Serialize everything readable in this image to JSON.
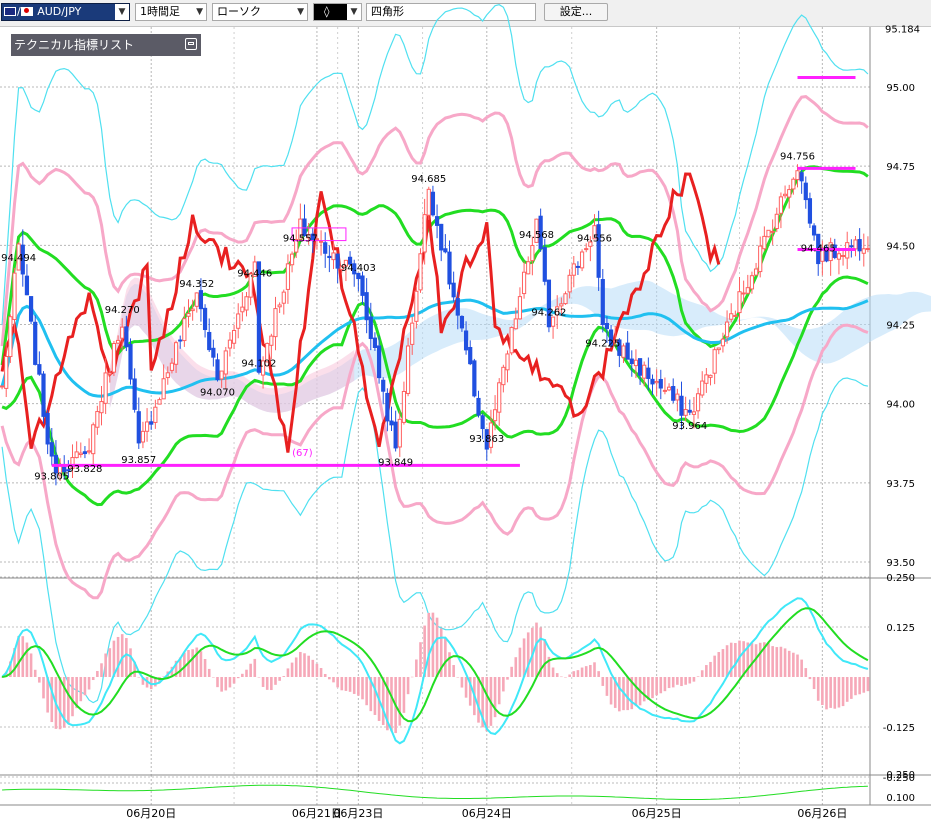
{
  "toolbar": {
    "symbol": "AUD/JPY",
    "timeframe": "1時間足",
    "chart_type": "ローソク",
    "draw_tool": "◊",
    "shape": "四角形",
    "settings_label": "設定..."
  },
  "indicator_panel": {
    "label": "テクニカル指標リスト"
  },
  "colors": {
    "bull": "#ff6060",
    "bear": "#2050e0",
    "red_line": "#e82020",
    "sma_green": "#22dd22",
    "bb_pink": "#f7a8c8",
    "bb_cyan": "#50e0f0",
    "mid_cyan": "#20c0f0",
    "magenta": "#ff20ff",
    "cloud": "#b8dcf8"
  },
  "chart_data": [
    {
      "type": "candlestick",
      "ylim": [
        93.45,
        95.2
      ],
      "yticks": [
        "95.00",
        "94.75",
        "94.50",
        "94.25",
        "94.00",
        "93.75",
        "93.50"
      ],
      "ytick_values": [
        95.0,
        94.75,
        94.5,
        94.25,
        94.0,
        93.75,
        93.5
      ],
      "ytop_label": "95.184",
      "ytop_value": 95.184,
      "xticks": [
        "06月20日",
        "06月21日",
        "06月23日",
        "06月24日",
        "06月25日",
        "06月26日"
      ],
      "xtick_index": [
        36,
        76,
        86,
        117,
        158,
        198
      ],
      "n_bars": 210,
      "price_labels": [
        {
          "text": "94.494",
          "i": 4,
          "v": 94.494
        },
        {
          "text": "93.805",
          "i": 12,
          "v": 93.805
        },
        {
          "text": "93.828",
          "i": 20,
          "v": 93.828
        },
        {
          "text": "94.270",
          "i": 29,
          "v": 94.27
        },
        {
          "text": "93.857",
          "i": 33,
          "v": 93.857
        },
        {
          "text": "94.352",
          "i": 47,
          "v": 94.352
        },
        {
          "text": "94.070",
          "i": 52,
          "v": 94.07
        },
        {
          "text": "94.446",
          "i": 61,
          "v": 94.446
        },
        {
          "text": "94.102",
          "i": 62,
          "v": 94.102
        },
        {
          "text": "94.557",
          "i": 72,
          "v": 94.557
        },
        {
          "text": "94.403",
          "i": 86,
          "v": 94.403
        },
        {
          "text": "93.849",
          "i": 95,
          "v": 93.849
        },
        {
          "text": "94.685",
          "i": 103,
          "v": 94.685
        },
        {
          "text": "93.863",
          "i": 117,
          "v": 93.863
        },
        {
          "text": "94.568",
          "i": 129,
          "v": 94.568
        },
        {
          "text": "94.262",
          "i": 132,
          "v": 94.262
        },
        {
          "text": "94.556",
          "i": 143,
          "v": 94.556
        },
        {
          "text": "94.225",
          "i": 145,
          "v": 94.225
        },
        {
          "text": "93.964",
          "i": 166,
          "v": 93.964
        },
        {
          "text": "94.756",
          "i": 192,
          "v": 94.756
        },
        {
          "text": "94.465",
          "i": 197,
          "v": 94.465
        }
      ],
      "period_label": "(67)",
      "support_level": 93.805,
      "resistance_levels": [
        95.03,
        94.743,
        94.487
      ]
    },
    {
      "type": "macd",
      "ylim": [
        -0.3,
        0.3
      ],
      "yticks": [
        "0.250",
        "0.125",
        "-0.125",
        "-0.250"
      ],
      "ytick_values": [
        0.25,
        0.125,
        -0.125,
        -0.25
      ]
    },
    {
      "type": "line",
      "yticks": [
        "0.250",
        "0.100"
      ],
      "ytick_values": [
        0.25,
        0.1
      ]
    }
  ]
}
